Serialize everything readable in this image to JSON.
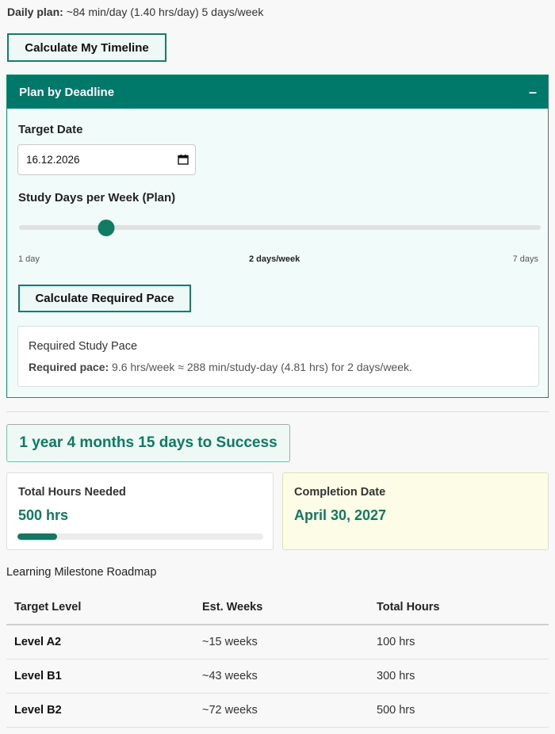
{
  "daily_plan": {
    "label": "Daily plan:",
    "value": "~84 min/day (1.40 hrs/day) 5 days/week"
  },
  "buttons": {
    "timeline": "Calculate My Timeline",
    "pace": "Calculate Required Pace"
  },
  "deadline_panel": {
    "title": "Plan by Deadline",
    "toggle": "–",
    "target_date_label": "Target Date",
    "target_date_value": "16.12.2026",
    "study_days_label": "Study Days per Week (Plan)",
    "slider": {
      "min": 1,
      "max": 7,
      "value": 2,
      "min_label": "1 day",
      "value_label": "2 days/week",
      "max_label": "7 days"
    },
    "result": {
      "title": "Required Study Pace",
      "label": "Required pace:",
      "text": "9.6 hrs/week ≈ 288 min/study-day (4.81 hrs) for 2 days/week."
    }
  },
  "success_banner": "1 year 4 months 15 days to Success",
  "stats": {
    "hours": {
      "label": "Total Hours Needed",
      "value": "500 hrs",
      "progress": 0.16
    },
    "completion": {
      "label": "Completion Date",
      "value": "April 30, 2027"
    }
  },
  "roadmap": {
    "title": "Learning Milestone Roadmap",
    "headers": [
      "Target Level",
      "Est. Weeks",
      "Total Hours"
    ],
    "rows": [
      [
        "Level A2",
        "~15 weeks",
        "100 hrs"
      ],
      [
        "Level B1",
        "~43 weeks",
        "300 hrs"
      ],
      [
        "Level B2",
        "~72 weeks",
        "500 hrs"
      ]
    ]
  },
  "colors": {
    "accent": "#00796b",
    "success_text": "#0f7a62",
    "completion_bg": "#fdfde7"
  }
}
